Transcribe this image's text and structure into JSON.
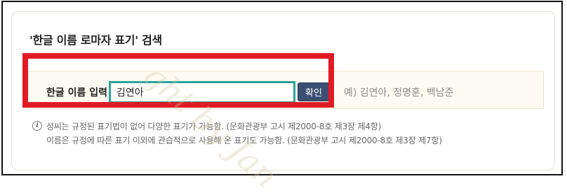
{
  "search": {
    "title": "'한글 이름 로마자 표기' 검색",
    "label": "한글 이름 입력",
    "input_value": "김연아",
    "confirm_label": "확인",
    "example_text": "예) 김연아, 정명훈, 백남준"
  },
  "notes": [
    "성씨는 규정된 표기법이 없어 다양한 표기가 가능함. (문화관광부 고시 제2000-8호 제3장 제4항)",
    "이름은 규정에 따른 표기 이외에 관습적으로 사용해 온 표기도 가능함. (문화관광부 고시 제2000-8호 제3장 제7항)"
  ],
  "icons": {
    "info": "info-icon"
  },
  "colors": {
    "highlight": "#e01b24",
    "input_border": "#2aa39a",
    "button": "#3b4f73"
  },
  "watermark": "ght by Jan"
}
